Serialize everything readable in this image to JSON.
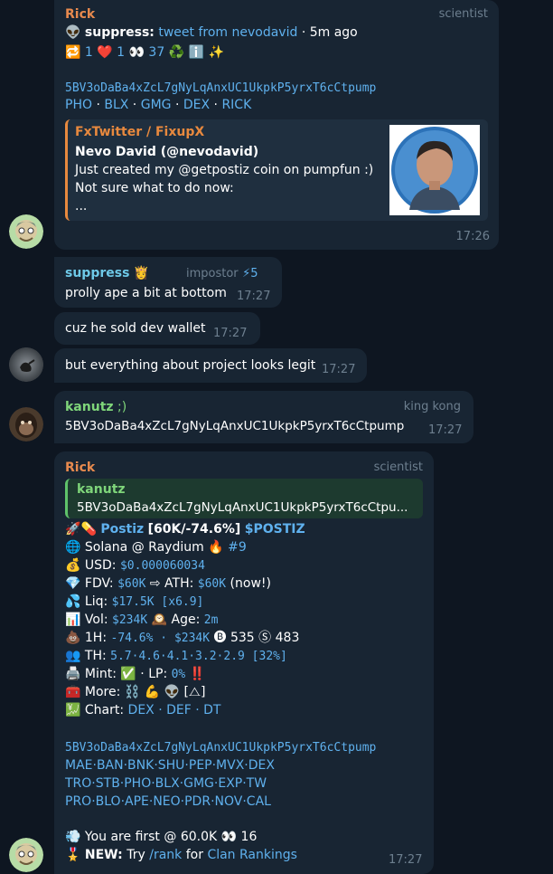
{
  "messages": {
    "m1": {
      "author": "Rick",
      "role": "scientist",
      "suppress_label": "suppress:",
      "tweet_link": "tweet from nevodavid",
      "ago": "· 5m ago",
      "stats": {
        "retweets": "1",
        "likes": "1",
        "views": "37"
      },
      "contract": "5BV3oDaBa4xZcL7gNyLqAnxUC1UkpkP5yrxT6cCtpump",
      "links": [
        "PHO",
        "BLX",
        "GMG",
        "DEX",
        "RICK"
      ],
      "preview": {
        "site": "FxTwitter / FixupX",
        "author": "Nevo David (@nevodavid)",
        "lines": [
          "Just created my @getpostiz  coin on pumpfun :)",
          "Not sure what to do now:",
          "..."
        ]
      },
      "time": "17:26"
    },
    "m2": {
      "author": "suppress",
      "role": "impostor",
      "badge": "5",
      "text": "prolly ape a bit at bottom",
      "time": "17:27"
    },
    "m3": {
      "text": "cuz he sold dev wallet",
      "time": "17:27"
    },
    "m4": {
      "text": "but everything about project looks legit",
      "time": "17:27"
    },
    "m5": {
      "author": "kanutz",
      "author_suffix": ";)",
      "role": "king kong",
      "text": "5BV3oDaBa4xZcL7gNyLqAnxUC1UkpkP5yrxT6cCtpump",
      "time": "17:27"
    },
    "m6": {
      "author": "Rick",
      "role": "scientist",
      "quote_author": "kanutz",
      "quote_text": "5BV3oDaBa4xZcL7gNyLqAnxUC1UkpkP5yrxT6cCtpu...",
      "token_name": "Postiz",
      "token_stats": "[60K/-74.6%]",
      "ticker": "$POSTIZ",
      "chain": "Solana @ Raydium",
      "rank": "#9",
      "usd_label": "USD:",
      "usd": "$0.000060034",
      "fdv_label": "FDV:",
      "fdv": "$60K",
      "ath_label": "⇨ ATH:",
      "ath": "$60K",
      "ath_note": "(now!)",
      "liq_label": "Liq:",
      "liq": "$17.5K [x6.9]",
      "vol_label": "Vol:",
      "vol": "$234K",
      "age_label": "Age:",
      "age": "2m",
      "h1_label": "1H:",
      "h1": "-74.6% · $234K",
      "buys": "535",
      "sells": "483",
      "th_label": "TH:",
      "th": "5.7·4.6·4.1·3.2·2.9 [32%]",
      "mint_label": "Mint:",
      "lp_label": "· LP:",
      "lp": "0%",
      "more_label": "More:",
      "more_tail": "[⧍]",
      "chart_label": "Chart:",
      "chart_links": "DEX · DEF · DT",
      "contract": "5BV3oDaBa4xZcL7gNyLqAnxUC1UkpkP5yrxT6cCtpump",
      "link_rows": [
        "MAE·BAN·BNK·SHU·PEP·MVX·DEX",
        "TRO·STB·PHO·BLX·GMG·EXP·TW",
        "PRO·BLO·APE·NEO·PDR·NOV·CAL"
      ],
      "first_text": "You are first @ 60.0K",
      "first_count": "16",
      "new_label": "NEW:",
      "new_try": "Try",
      "rank_cmd": "/rank",
      "new_for": "for",
      "clan": "Clan Rankings",
      "time": "17:27"
    }
  },
  "colors": {
    "background": "#0e1621",
    "bubble": "#182533",
    "link": "#5fb1ee",
    "rick": "#e88a4e",
    "suppress": "#6ec9e8",
    "kanutz": "#7fd67a"
  }
}
